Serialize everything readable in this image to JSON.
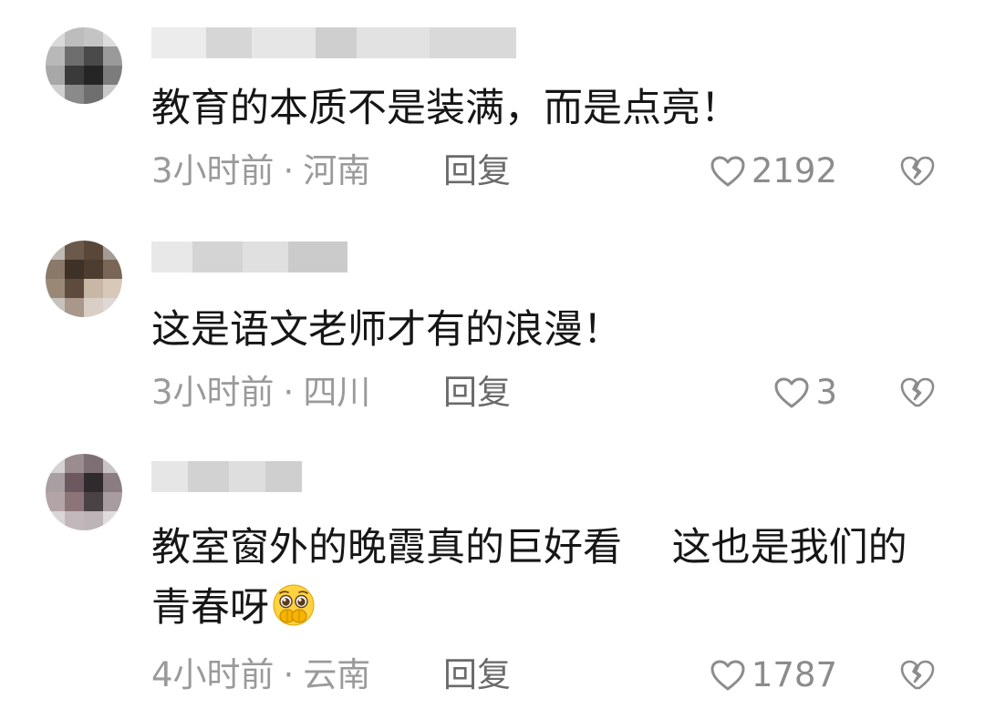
{
  "comments": [
    {
      "text": "教育的本质不是装满，而是点亮！",
      "time": "3小时前",
      "location": "河南",
      "reply_label": "回复",
      "likes": "2192"
    },
    {
      "text": "这是语文老师才有的浪漫！",
      "time": "3小时前",
      "location": "四川",
      "reply_label": "回复",
      "likes": "3"
    },
    {
      "text": "教室窗外的晚霞真的巨好看    这也是我们的青春呀",
      "time": "4小时前",
      "location": "云南",
      "reply_label": "回复",
      "likes": "1787"
    }
  ],
  "meta_separator": "·",
  "icons": {
    "like": "heart-outline-icon",
    "dislike": "broken-heart-icon",
    "emoji": "pleading-face-emoji"
  },
  "colors": {
    "text": "#161616",
    "meta": "#9a9a9a",
    "reply": "#6a6a6a",
    "icon": "#8c8c8c"
  }
}
